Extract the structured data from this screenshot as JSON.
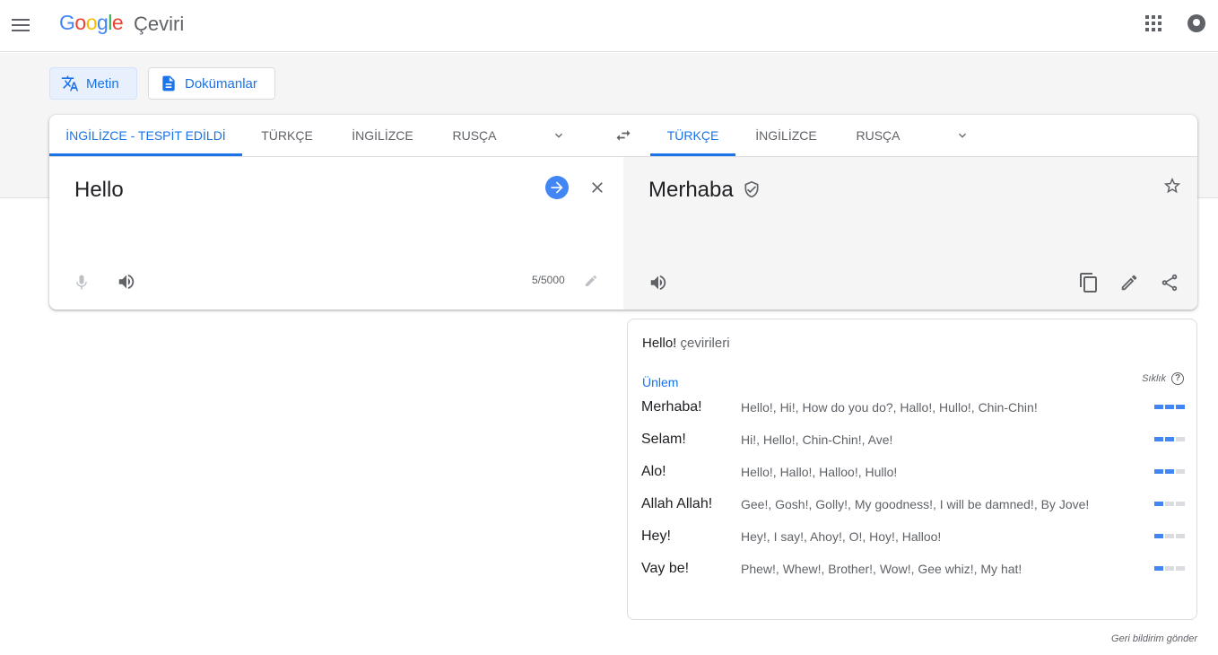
{
  "header": {
    "logo_letters": [
      "G",
      "o",
      "o",
      "g",
      "l",
      "e"
    ],
    "product_name": "Çeviri",
    "icons": [
      "menu-icon",
      "apps-grid-icon",
      "account-icon"
    ]
  },
  "modes": {
    "text_label": "Metin",
    "documents_label": "Dokümanlar"
  },
  "source_tabs": [
    "İNGİLİZCE - TESPİT EDİLDİ",
    "TÜRKÇE",
    "İNGİLİZCE",
    "RUSÇA"
  ],
  "target_tabs": [
    "TÜRKÇE",
    "İNGİLİZCE",
    "RUSÇA"
  ],
  "source": {
    "text": "Hello",
    "char_count": "5/5000"
  },
  "target": {
    "text": "Merhaba"
  },
  "dictionary": {
    "title_word": "Hello!",
    "title_suffix": "çevirileri",
    "part_of_speech": "Ünlem",
    "frequency_label": "Sıklık",
    "help_glyph": "?",
    "entries": [
      {
        "word": "Merhaba!",
        "synonyms": "Hello!, Hi!, How do you do?, Hallo!, Hullo!, Chin-Chin!",
        "frequency": 3
      },
      {
        "word": "Selam!",
        "synonyms": "Hi!, Hello!, Chin-Chin!, Ave!",
        "frequency": 2
      },
      {
        "word": "Alo!",
        "synonyms": "Hello!, Hallo!, Halloo!, Hullo!",
        "frequency": 2
      },
      {
        "word": "Allah Allah!",
        "synonyms": "Gee!, Gosh!, Golly!, My goodness!, I will be damned!, By Jove!",
        "frequency": 1
      },
      {
        "word": "Hey!",
        "synonyms": "Hey!, I say!, Ahoy!, O!, Hoy!, Halloo!",
        "frequency": 1
      },
      {
        "word": "Vay be!",
        "synonyms": "Phew!, Whew!, Brother!, Wow!, Gee whiz!, My hat!",
        "frequency": 1
      }
    ]
  },
  "footer": {
    "feedback": "Geri bildirim gönder"
  },
  "colors": {
    "accent": "#1a73e8",
    "freq_on": "#4285f4",
    "freq_off": "#dadce0"
  }
}
